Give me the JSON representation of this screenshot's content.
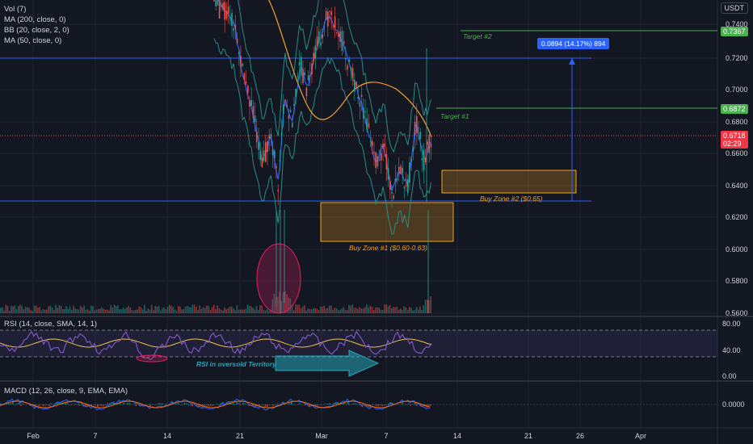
{
  "legend": {
    "vol": "Vol (7)",
    "ma200": "MA (200, close, 0)",
    "bb": "BB (20, close, 2, 0)",
    "ma50": "MA (50, close, 0)"
  },
  "currency_button": "USDT",
  "price_axis": {
    "labels": [
      "0.7400",
      "0.7200",
      "0.7000",
      "0.6800",
      "0.6600",
      "0.6400",
      "0.6200",
      "0.6000",
      "0.5800",
      "0.5600"
    ],
    "target2_price": "0.7367",
    "target1_price": "0.6872",
    "last_price": "0.6718",
    "countdown": "02:29"
  },
  "annotations": {
    "target2": "Target #2",
    "target1": "Target #1",
    "measure": "0.0894 (14.17%) 894",
    "buy_zone1": "Buy Zone #1 ($0.60-0.63)",
    "buy_zone2": "Buy Zone #2 ($0.65)",
    "rsi_note": "RSI in oversold Territory"
  },
  "rsi": {
    "title": "RSI (14, close, SMA, 14, 1)",
    "levels": [
      "80.00",
      "40.00",
      "0.00"
    ]
  },
  "macd": {
    "title": "MACD (12, 26, close, 9, EMA, EMA)",
    "level": "0.0000"
  },
  "time_axis": [
    "Feb",
    "7",
    "14",
    "21",
    "Mar",
    "7",
    "14",
    "21",
    "26",
    "Apr"
  ],
  "colors": {
    "background": "#131722",
    "candle_up": "#26a69a",
    "candle_down": "#ef5350",
    "ma200": "#f0a22e",
    "bb": "#2a8c88",
    "ma50": "#2962ff",
    "target": "#4caf50",
    "zone": "#f59f1a",
    "price_tag": "#f23645",
    "measure": "#2962ff",
    "rsi": "#7e57c2"
  }
}
